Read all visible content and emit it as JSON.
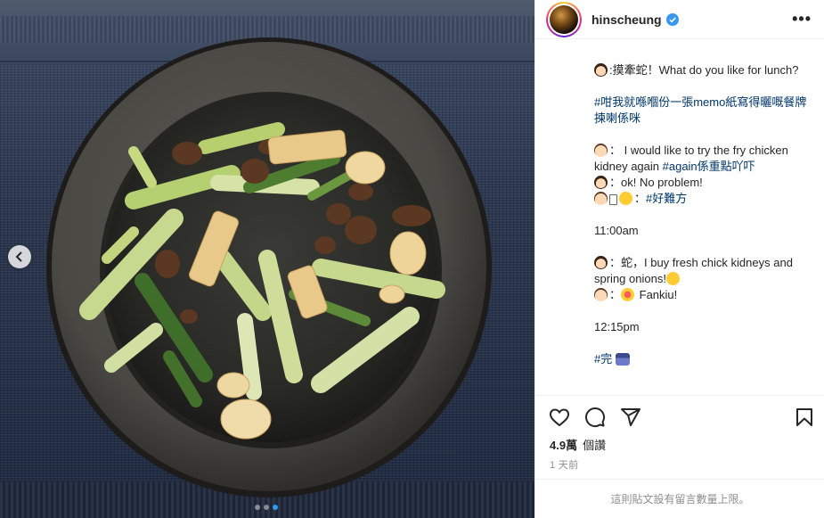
{
  "post": {
    "username": "hinscheung",
    "verified": true,
    "more_label": "•••",
    "carousel": {
      "count": 3,
      "active_index": 2
    }
  },
  "caption": {
    "l1": ":摸牽蛇！What do you like for lunch?",
    "l2": "#咁我就喺嗰份一張memo紙寫得曬嘅餐牌揀喇係咪",
    "l3": "： I would like to try the fry chicken kidney again ",
    "l3_tag": "#again係重點吖吓",
    "l4": "：ok! No problem!",
    "l5_tag": "#好難方",
    "l5_prefix": "：",
    "l6": "11:00am",
    "l7": "：蛇，I buy fresh chick kidneys and spring onions!",
    "l8": " Fankiu!",
    "l8_prefix": "：",
    "l9": "12:15pm",
    "l10_tag": "#完"
  },
  "stats": {
    "views": "4.9萬",
    "views_label": "個讚",
    "time_ago": "1 天前"
  },
  "footer": {
    "notice": "這則貼文設有留言數量上限。"
  },
  "icons": {
    "like": "heart-icon",
    "comment": "comment-icon",
    "share": "share-icon",
    "save": "bookmark-icon",
    "prev": "chevron-left-icon"
  },
  "colors": {
    "accent": "#0095f6",
    "hashtag": "#00376b",
    "muted": "#8e8e8e"
  }
}
